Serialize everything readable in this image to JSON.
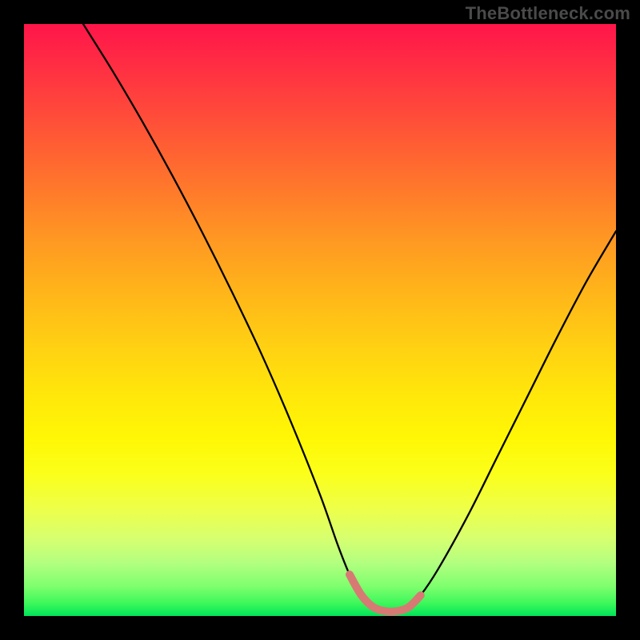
{
  "watermark": "TheBottleneck.com",
  "chart_data": {
    "type": "line",
    "title": "",
    "xlabel": "",
    "ylabel": "",
    "xlim": [
      0,
      100
    ],
    "ylim": [
      0,
      100
    ],
    "grid": false,
    "description": "Bottleneck curve: vertical axis is bottleneck severity (top = red = severe, bottom = green = none). The black V-shaped curve descends from the upper-left, reaches a flat minimum near x≈57–65 (highlighted by a rose-colored segment), then rises toward the upper-right. The rainbow gradient background encodes severity from red (top) to green (bottom).",
    "series": [
      {
        "name": "bottleneck-curve",
        "x": [
          10,
          15,
          20,
          25,
          30,
          35,
          40,
          45,
          50,
          53,
          55,
          57,
          59,
          61,
          63,
          65,
          67,
          70,
          75,
          80,
          85,
          90,
          95,
          100
        ],
        "y": [
          100,
          92,
          83.5,
          74.5,
          65,
          55,
          44.5,
          33,
          20.5,
          12,
          7,
          3.5,
          1.5,
          0.8,
          0.8,
          1.5,
          3.5,
          8,
          17,
          27,
          37,
          47,
          56.5,
          65
        ]
      },
      {
        "name": "optimal-zone-highlight",
        "x": [
          55,
          57,
          59,
          61,
          63,
          65,
          67
        ],
        "y": [
          7,
          3.5,
          1.5,
          0.8,
          0.8,
          1.5,
          3.5
        ]
      }
    ],
    "gradient_stops": [
      {
        "pos": 0.0,
        "color": "#ff154a"
      },
      {
        "pos": 0.15,
        "color": "#ff4a3a"
      },
      {
        "pos": 0.35,
        "color": "#ff9324"
      },
      {
        "pos": 0.55,
        "color": "#ffd212"
      },
      {
        "pos": 0.76,
        "color": "#fbff1a"
      },
      {
        "pos": 0.91,
        "color": "#b3ff80"
      },
      {
        "pos": 1.0,
        "color": "#00e35a"
      }
    ],
    "highlight_color": "#d77a74"
  }
}
